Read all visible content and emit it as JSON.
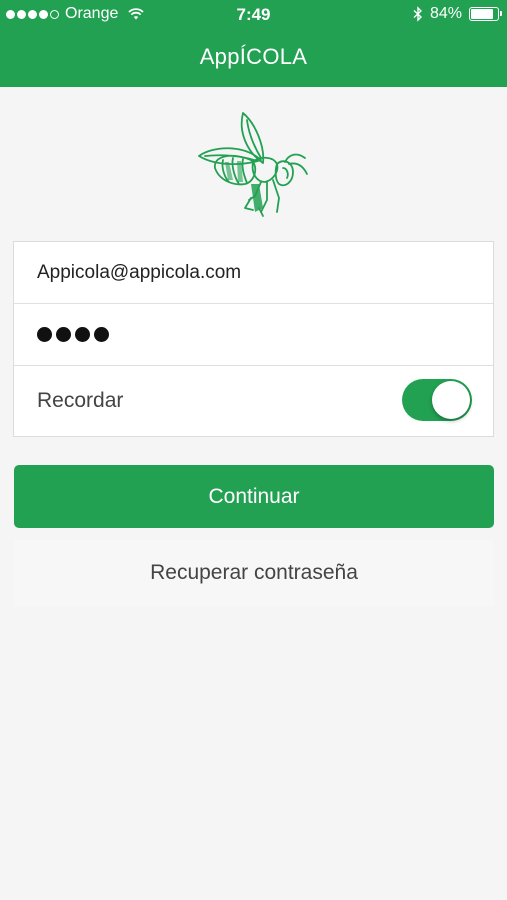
{
  "status_bar": {
    "carrier": "Orange",
    "time": "7:49",
    "battery_percent": "84%",
    "battery_level": 0.84,
    "signal_bars_filled": 4,
    "signal_bars_total": 5
  },
  "header": {
    "title": "AppÍCOLA"
  },
  "colors": {
    "brand": "#22a152",
    "background": "#f5f5f5"
  },
  "logo": {
    "icon": "bee-icon"
  },
  "form": {
    "email_value": "Appicola@appicola.com",
    "password_length": 4,
    "remember_label": "Recordar",
    "remember_on": true
  },
  "actions": {
    "continue_label": "Continuar",
    "recover_label": "Recuperar contraseña"
  }
}
